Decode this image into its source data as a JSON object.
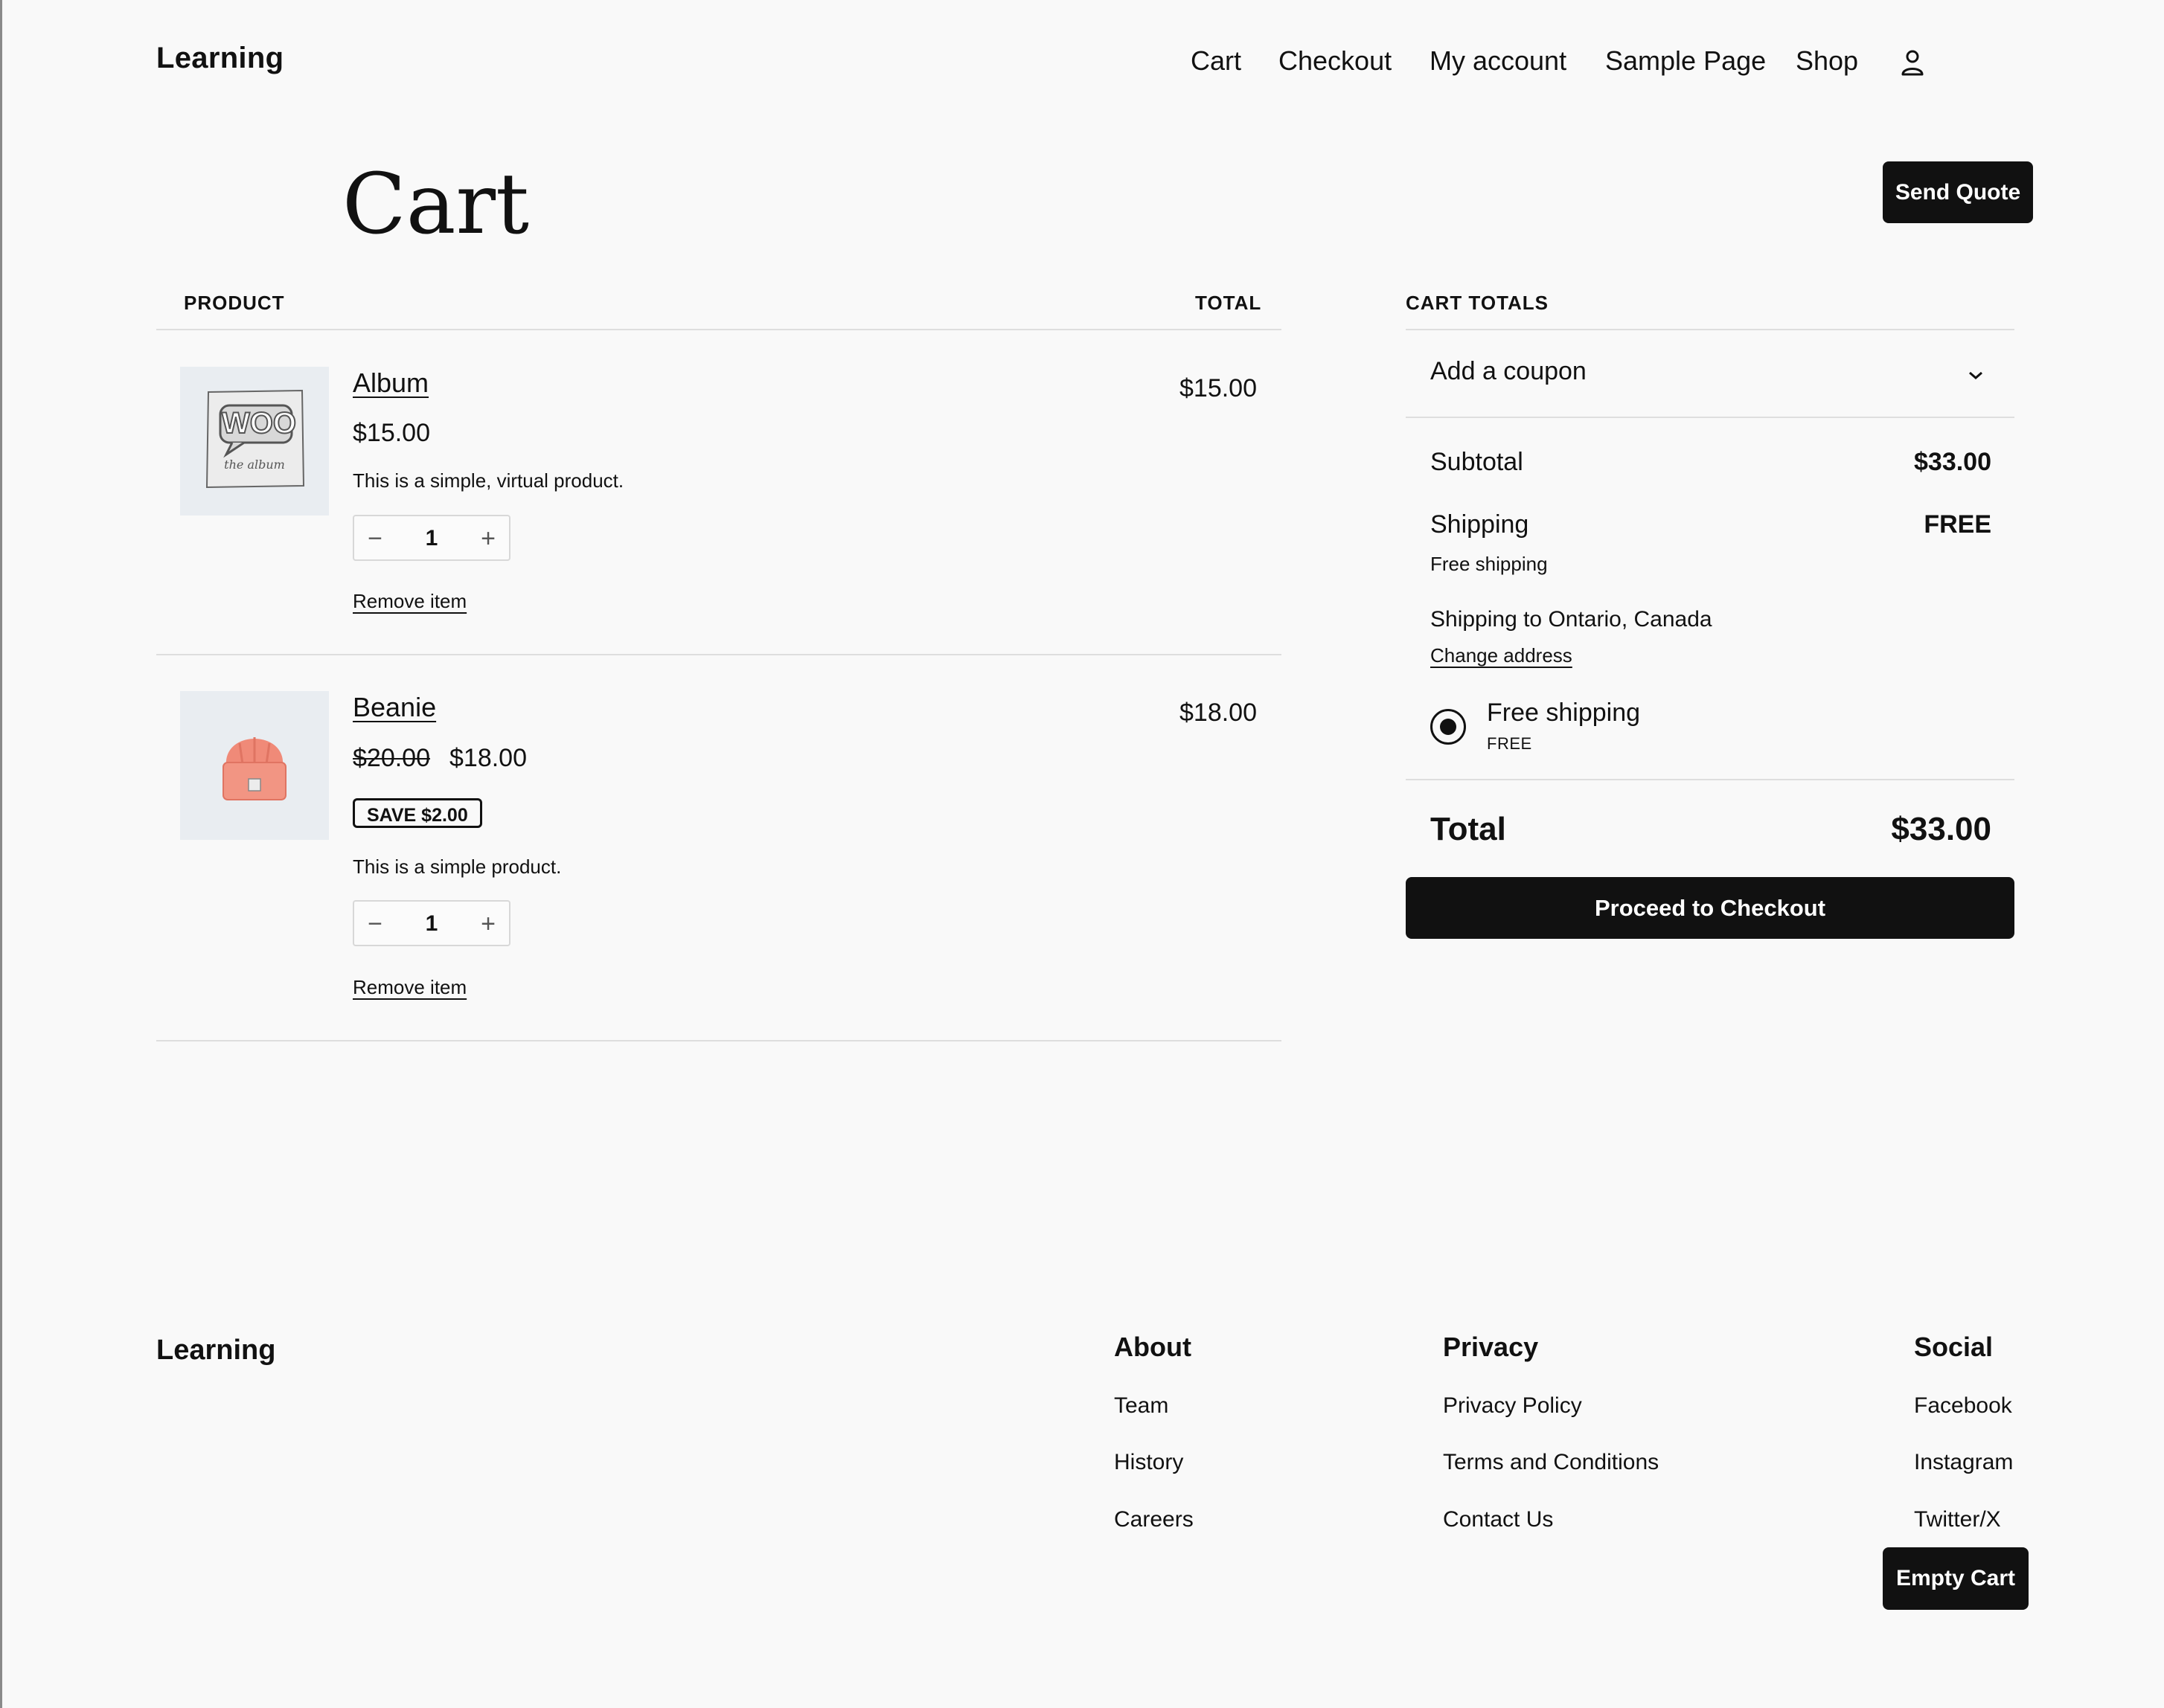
{
  "header": {
    "site_title": "Learning",
    "nav": [
      "Cart",
      "Checkout",
      "My account",
      "Sample Page",
      "Shop"
    ],
    "account_icon": "user-icon"
  },
  "page": {
    "title": "Cart",
    "send_quote_label": "Send Quote"
  },
  "cart_table": {
    "col_product": "PRODUCT",
    "col_total": "TOTAL",
    "items": [
      {
        "name": "Album",
        "price": "$15.00",
        "description": "This is a simple, virtual product.",
        "quantity": "1",
        "remove_label": "Remove item",
        "line_total": "$15.00",
        "image_text": "WOO",
        "image_caption": "the album"
      },
      {
        "name": "Beanie",
        "original_price": "$20.00",
        "price": "$18.00",
        "save_badge": "SAVE $2.00",
        "description": "This is a simple product.",
        "quantity": "1",
        "remove_label": "Remove item",
        "line_total": "$18.00"
      }
    ]
  },
  "totals": {
    "heading": "CART TOTALS",
    "coupon_label": "Add a coupon",
    "subtotal_label": "Subtotal",
    "subtotal_value": "$33.00",
    "shipping_label": "Shipping",
    "shipping_value": "FREE",
    "shipping_method": "Free shipping",
    "shipping_to": "Shipping to Ontario, Canada",
    "change_address": "Change address",
    "option_label": "Free shipping",
    "option_price": "FREE",
    "total_label": "Total",
    "total_value": "$33.00",
    "checkout_label": "Proceed to Checkout"
  },
  "footer": {
    "site_title": "Learning",
    "about": {
      "heading": "About",
      "links": [
        "Team",
        "History",
        "Careers"
      ]
    },
    "privacy": {
      "heading": "Privacy",
      "links": [
        "Privacy Policy",
        "Terms and Conditions",
        "Contact Us"
      ]
    },
    "social": {
      "heading": "Social",
      "links": [
        "Facebook",
        "Instagram",
        "Twitter/X"
      ]
    },
    "empty_cart_label": "Empty Cart"
  },
  "colors": {
    "background": "#f9f9f9",
    "primary": "#111111",
    "thumb_bg": "#e9edf1",
    "beanie": "#f08a78"
  }
}
